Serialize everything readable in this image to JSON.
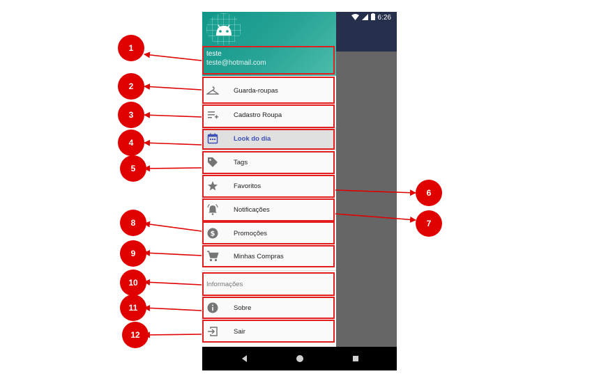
{
  "status_bar": {
    "time": "6:26",
    "icons": [
      "wifi-icon",
      "signal-icon",
      "battery-icon"
    ]
  },
  "drawer_header": {
    "name": "teste",
    "email": "teste@hotmail.com",
    "avatar_icon": "android-icon"
  },
  "menu_items": [
    {
      "label": "Guarda-roupas",
      "icon": "hanger-icon"
    },
    {
      "label": "Cadastro Roupa",
      "icon": "playlist-add-icon"
    },
    {
      "label": "Look do dia",
      "icon": "calendar-icon",
      "selected": true
    },
    {
      "label": "Tags",
      "icon": "tag-icon"
    },
    {
      "label": "Favoritos",
      "icon": "star-icon"
    },
    {
      "label": "Notificações",
      "icon": "bell-ring-icon"
    },
    {
      "label": "Promoções",
      "icon": "dollar-coin-icon"
    },
    {
      "label": "Minhas Compras",
      "icon": "cart-icon"
    }
  ],
  "section_title": "Informações",
  "info_items": [
    {
      "label": "Sobre",
      "icon": "info-icon"
    },
    {
      "label": "Sair",
      "icon": "exit-icon"
    }
  ],
  "nav_bar": {
    "buttons": [
      "back-icon",
      "home-icon",
      "recents-icon"
    ]
  },
  "callouts": [
    "1",
    "2",
    "3",
    "4",
    "5",
    "6",
    "7",
    "8",
    "9",
    "10",
    "11",
    "12"
  ],
  "colors": {
    "header_start": "#0f9688",
    "header_end": "#4dbdad",
    "selected_text": "#3f51b5",
    "callout_red": "#e00000",
    "scrim": "#666666"
  }
}
